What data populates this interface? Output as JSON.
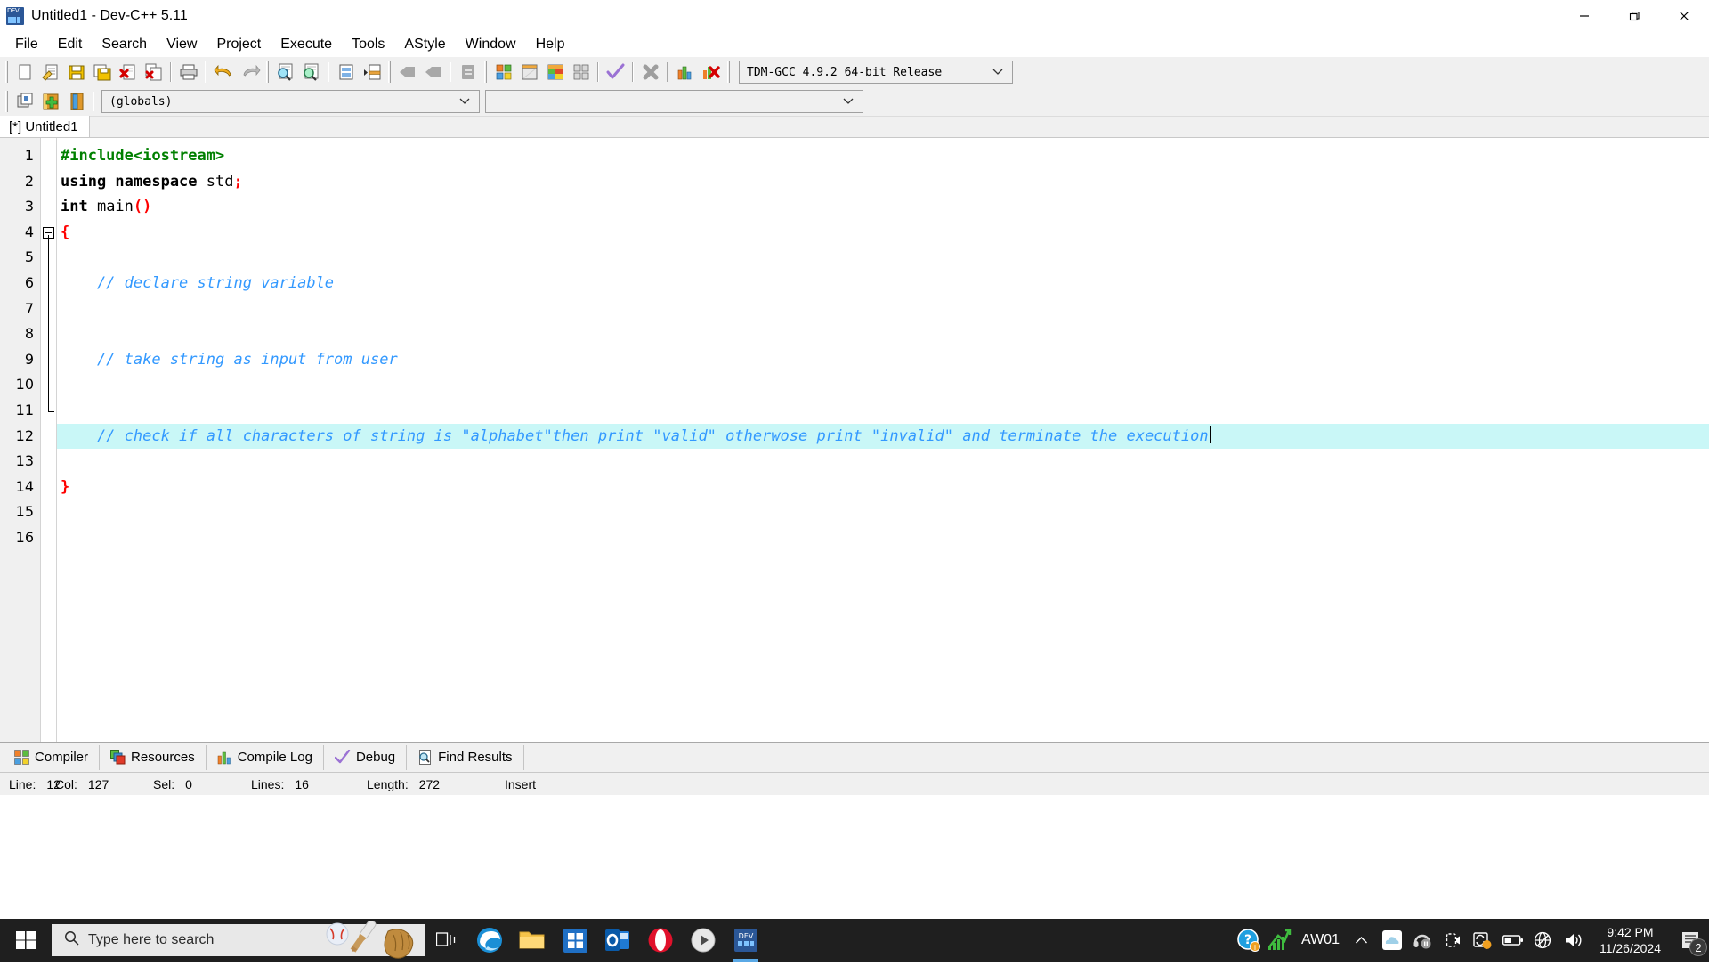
{
  "window": {
    "title": "Untitled1 - Dev-C++ 5.11",
    "app_icon": "dev-cpp-icon",
    "controls": {
      "minimize": "minimize-icon",
      "maximize": "restore-icon",
      "close": "close-icon"
    }
  },
  "menubar": {
    "items": [
      {
        "label": "File"
      },
      {
        "label": "Edit"
      },
      {
        "label": "Search"
      },
      {
        "label": "View"
      },
      {
        "label": "Project"
      },
      {
        "label": "Execute"
      },
      {
        "label": "Tools"
      },
      {
        "label": "AStyle"
      },
      {
        "label": "Window"
      },
      {
        "label": "Help"
      }
    ]
  },
  "toolbar": {
    "buttons": [
      {
        "name": "new-file-icon"
      },
      {
        "name": "open-file-icon"
      },
      {
        "name": "save-file-icon"
      },
      {
        "name": "save-all-icon"
      },
      {
        "name": "close-file-icon"
      },
      {
        "name": "close-all-icon"
      },
      {
        "name": "print-icon"
      },
      {
        "name": "undo-icon"
      },
      {
        "name": "redo-icon"
      },
      {
        "name": "find-icon"
      },
      {
        "name": "replace-icon"
      },
      {
        "name": "goto-line-icon"
      },
      {
        "name": "goto-function-icon"
      },
      {
        "name": "back-icon"
      },
      {
        "name": "forward-icon"
      },
      {
        "name": "toggle-breakpoint-icon"
      },
      {
        "name": "compile-icon"
      },
      {
        "name": "run-icon"
      },
      {
        "name": "compile-run-icon"
      },
      {
        "name": "rebuild-all-icon"
      },
      {
        "name": "syntax-check-icon"
      },
      {
        "name": "stop-execution-icon"
      },
      {
        "name": "profile-icon"
      },
      {
        "name": "delete-profile-icon"
      }
    ],
    "compiler_select": {
      "value": "TDM-GCC 4.9.2 64-bit Release",
      "name": "compiler-select"
    }
  },
  "toolbar2": {
    "buttons": [
      {
        "name": "project-manager-icon"
      },
      {
        "name": "add-to-project-icon"
      },
      {
        "name": "class-browser-icon"
      }
    ],
    "scope_select": {
      "value": "(globals)",
      "name": "scope-select"
    },
    "member_select": {
      "value": "",
      "name": "member-select"
    }
  },
  "editor": {
    "tab_label": "[*] Untitled1",
    "line_numbers": [
      "1",
      "2",
      "3",
      "4",
      "5",
      "6",
      "7",
      "8",
      "9",
      "10",
      "11",
      "12",
      "13",
      "14",
      "15",
      "16"
    ],
    "lines": [
      {
        "n": 1,
        "highlight": false,
        "tokens": [
          {
            "t": "#include<iostream>",
            "c": "pp"
          }
        ]
      },
      {
        "n": 2,
        "highlight": false,
        "tokens": [
          {
            "t": "using namespace",
            "c": "kw"
          },
          {
            "t": " std",
            "c": "pl"
          },
          {
            "t": ";",
            "c": "pn"
          }
        ]
      },
      {
        "n": 3,
        "highlight": false,
        "tokens": [
          {
            "t": "int",
            "c": "kw"
          },
          {
            "t": " main",
            "c": "pl"
          },
          {
            "t": "()",
            "c": "pn"
          }
        ]
      },
      {
        "n": 4,
        "highlight": false,
        "tokens": [
          {
            "t": "{",
            "c": "pn"
          }
        ]
      },
      {
        "n": 5,
        "highlight": false,
        "tokens": []
      },
      {
        "n": 6,
        "highlight": false,
        "tokens": [
          {
            "t": "    // declare string variable",
            "c": "cm"
          }
        ]
      },
      {
        "n": 7,
        "highlight": false,
        "tokens": []
      },
      {
        "n": 8,
        "highlight": false,
        "tokens": []
      },
      {
        "n": 9,
        "highlight": false,
        "tokens": [
          {
            "t": "    // take string as input from user",
            "c": "cm"
          }
        ]
      },
      {
        "n": 10,
        "highlight": false,
        "tokens": []
      },
      {
        "n": 11,
        "highlight": false,
        "tokens": []
      },
      {
        "n": 12,
        "highlight": true,
        "tokens": [
          {
            "t": "    // check if all characters of string is \"alphabet\"then print \"valid\" otherwose print \"invalid\" and terminate the execution",
            "c": "cm"
          }
        ],
        "caret": true
      },
      {
        "n": 13,
        "highlight": false,
        "tokens": []
      },
      {
        "n": 14,
        "highlight": false,
        "tokens": [
          {
            "t": "}",
            "c": "pn"
          }
        ]
      },
      {
        "n": 15,
        "highlight": false,
        "tokens": []
      },
      {
        "n": 16,
        "highlight": false,
        "tokens": []
      }
    ]
  },
  "bottom_panel": {
    "tabs": [
      {
        "label": "Compiler",
        "icon": "compiler-icon"
      },
      {
        "label": "Resources",
        "icon": "resources-icon"
      },
      {
        "label": "Compile Log",
        "icon": "compile-log-icon"
      },
      {
        "label": "Debug",
        "icon": "debug-check-icon"
      },
      {
        "label": "Find Results",
        "icon": "find-results-icon"
      }
    ]
  },
  "statusbar": {
    "line_label": "Line:",
    "line_value": "12",
    "col_label": "Col:",
    "col_value": "127",
    "sel_label": "Sel:",
    "sel_value": "0",
    "lines_label": "Lines:",
    "lines_value": "16",
    "length_label": "Length:",
    "length_value": "272",
    "mode": "Insert"
  },
  "taskbar": {
    "start": "windows-start-icon",
    "search_placeholder": "Type here to search",
    "search_icon": "search-icon",
    "search_decoration": "baseball-bat-glove-icon",
    "pinned": [
      {
        "name": "task-view-icon"
      },
      {
        "name": "microsoft-edge-icon"
      },
      {
        "name": "file-explorer-icon"
      },
      {
        "name": "microsoft-store-icon"
      },
      {
        "name": "outlook-icon"
      },
      {
        "name": "opera-icon"
      },
      {
        "name": "media-player-icon"
      },
      {
        "name": "dev-cpp-taskbar-icon"
      }
    ],
    "tray": {
      "help_icon": "help-question-icon",
      "network_monitor_icon": "network-graph-icon",
      "device_label": "AW01",
      "chevron": "show-hidden-icons-icon",
      "icons": [
        {
          "name": "onedrive-icon"
        },
        {
          "name": "headphones-icon"
        },
        {
          "name": "webcam-icon"
        },
        {
          "name": "sync-icon"
        },
        {
          "name": "battery-icon"
        },
        {
          "name": "network-disconnected-icon"
        },
        {
          "name": "volume-icon"
        }
      ],
      "time": "9:42 PM",
      "date": "11/26/2024",
      "notification_icon": "action-center-icon",
      "notification_count": "2"
    }
  },
  "colors": {
    "comment": "#3399ff",
    "preprocessor": "#008000",
    "punctuation": "#ff0000",
    "highlight_line": "#c9f7f7",
    "chrome": "#f0f0f0",
    "taskbar": "#1f1f1f"
  }
}
